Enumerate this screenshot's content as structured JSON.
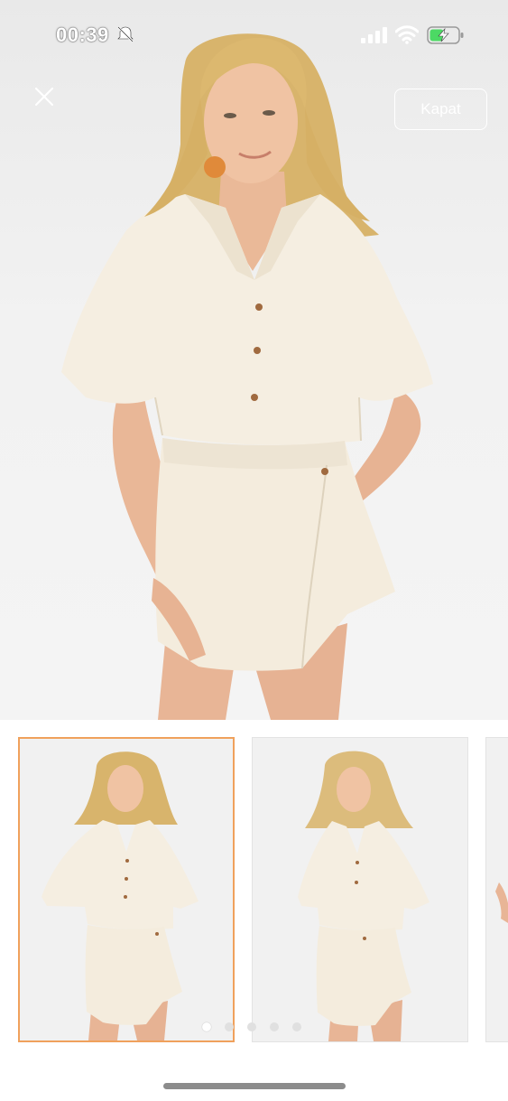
{
  "status_bar": {
    "time": "00:39",
    "icons": [
      "bell-slash-icon",
      "signal-icon",
      "wifi-icon",
      "battery-charging-icon"
    ],
    "battery_color": "#4cd964"
  },
  "header": {
    "close_icon": "close-icon",
    "close_label": "Kapat"
  },
  "gallery": {
    "main_image": "model-wearing-cream-shirt-and-wrap-skort",
    "thumbnails": [
      {
        "name": "thumbnail-front",
        "selected": true
      },
      {
        "name": "thumbnail-angle",
        "selected": false
      },
      {
        "name": "thumbnail-side",
        "selected": false
      }
    ],
    "page_indicator": {
      "count": 5,
      "active_index": 0
    },
    "selected_border_color": "#f0a15c"
  },
  "colors": {
    "garment": "#f4ecdd",
    "skin": "#e9b89a",
    "hair": "#d9b56e"
  }
}
